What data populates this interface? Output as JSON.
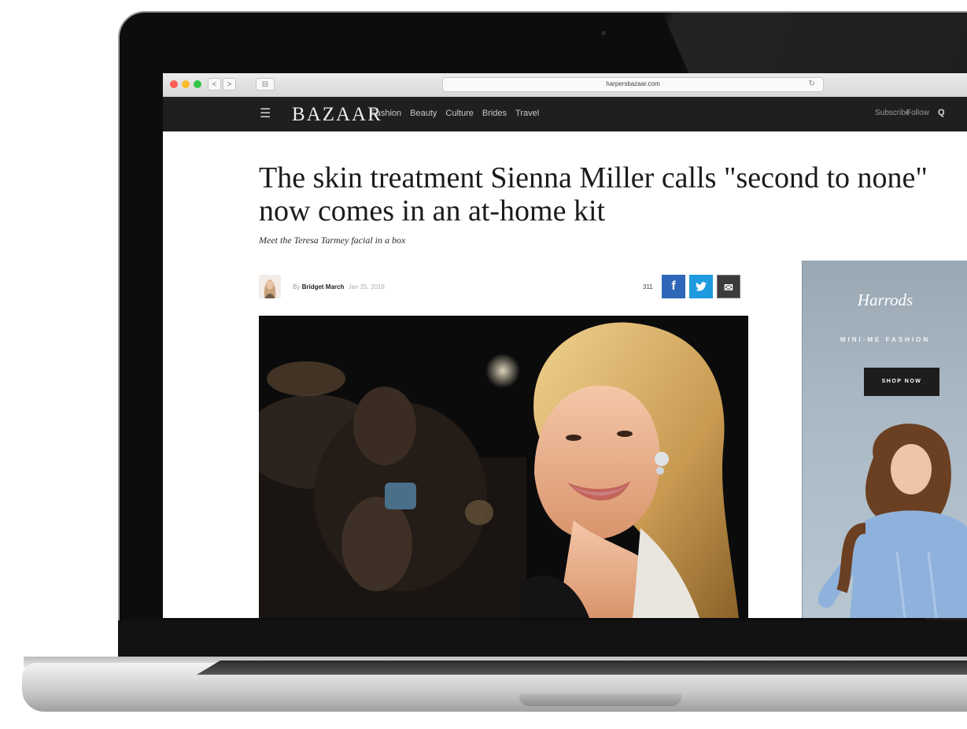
{
  "browser": {
    "url": "harpersbazaar.com",
    "back_label": "<",
    "forward_label": ">",
    "sidebar_label": "⊟",
    "reload_label": "↻"
  },
  "site": {
    "logo": "BAZAAR",
    "menu_icon": "☰",
    "nav": [
      "Fashion",
      "Beauty",
      "Culture",
      "Brides",
      "Travel"
    ],
    "subscribe": "Subscribe",
    "follow": "Follow",
    "search_icon": "Q"
  },
  "article": {
    "headline_line1": "The skin treatment Sienna Miller calls \"second to none\"",
    "headline_line2": "now comes in an at-home kit",
    "dek": "Meet the Teresa Tarmey facial in a box",
    "byline_prefix": "By",
    "author": "Bridget March",
    "date": "Jan 25, 2018",
    "share_count": "311",
    "share_facebook": "f",
    "share_twitter": "t",
    "share_email": "✉"
  },
  "ad": {
    "brand": "Harrods",
    "tagline": "MINI-ME FASHION",
    "cta": "SHOP NOW"
  },
  "colors": {
    "nav_bg": "#1f1f1f",
    "facebook": "#2e66b8",
    "twitter": "#1d9ae0",
    "ad_bg": "#a9b8c3"
  }
}
